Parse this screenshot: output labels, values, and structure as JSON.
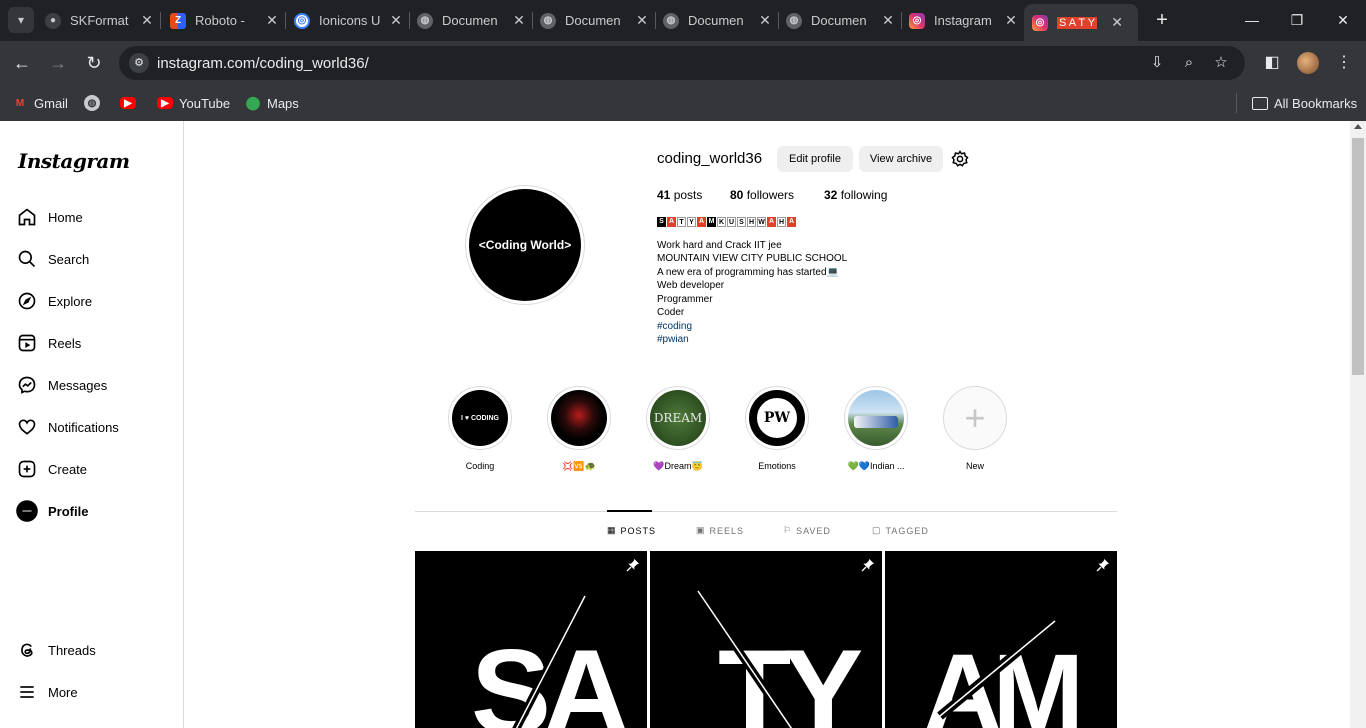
{
  "browser": {
    "tabs": [
      {
        "label": "SKFormat",
        "icon": "github-icon"
      },
      {
        "label": "Roboto -",
        "icon": "zb-icon"
      },
      {
        "label": "Ionicons U",
        "icon": "ionicons-icon"
      },
      {
        "label": "Documen",
        "icon": "globe-icon"
      },
      {
        "label": "Documen",
        "icon": "globe-icon"
      },
      {
        "label": "Documen",
        "icon": "globe-icon"
      },
      {
        "label": "Documen",
        "icon": "globe-icon"
      },
      {
        "label": "Instagram",
        "icon": "instagram-icon"
      },
      {
        "label": "S A T Y",
        "icon": "instagram-icon"
      }
    ],
    "url": "instagram.com/coding_world36/",
    "bookmarks": [
      {
        "label": "Gmail"
      },
      {
        "label": ""
      },
      {
        "label": ""
      },
      {
        "label": "YouTube"
      },
      {
        "label": "Maps"
      }
    ],
    "all_bookmarks": "All Bookmarks"
  },
  "sidebar": {
    "logo": "Instagram",
    "items": [
      {
        "label": "Home",
        "icon": "home-icon"
      },
      {
        "label": "Search",
        "icon": "search-icon"
      },
      {
        "label": "Explore",
        "icon": "compass-icon"
      },
      {
        "label": "Reels",
        "icon": "reels-icon"
      },
      {
        "label": "Messages",
        "icon": "messenger-icon"
      },
      {
        "label": "Notifications",
        "icon": "heart-icon"
      },
      {
        "label": "Create",
        "icon": "plus-square-icon"
      },
      {
        "label": "Profile",
        "icon": "profile-avatar-icon"
      }
    ],
    "threads": "Threads",
    "more": "More"
  },
  "profile": {
    "username": "coding_world36",
    "edit_profile": "Edit profile",
    "view_archive": "View archive",
    "posts_count": "41",
    "posts_label": "posts",
    "followers_count": "80",
    "followers_label": "followers",
    "following_count": "32",
    "following_label": "following",
    "full_name_letters": [
      "S",
      "A",
      "T",
      "Y",
      "A",
      "M",
      "K",
      "U",
      "S",
      "H",
      "W",
      "A",
      "H",
      "A"
    ],
    "avatar_text": "<Coding World>",
    "bio": [
      "Work hard and Crack IIT jee",
      "MOUNTAIN VIEW CITY PUBLIC SCHOOL",
      "A new era of programming has started💻",
      "Web developer",
      "Programmer",
      "Coder"
    ],
    "hashtags": [
      "#coding",
      "#pwian"
    ]
  },
  "highlights": [
    {
      "label": "Coding"
    },
    {
      "label": "💢🆚🐢"
    },
    {
      "label": "💜Dream😇"
    },
    {
      "label": "Emotions"
    },
    {
      "label": "💚💙Indian ..."
    },
    {
      "label": "New"
    }
  ],
  "highlight_texts": {
    "coding_img": "I ♥ CODING",
    "dream_img": "DREAM",
    "pw_img": "PW"
  },
  "profile_tabs": [
    {
      "label": "POSTS"
    },
    {
      "label": "REELS"
    },
    {
      "label": "SAVED"
    },
    {
      "label": "TAGGED"
    }
  ],
  "posts": [
    {
      "text": "SA",
      "pinned": true
    },
    {
      "text": "TY",
      "pinned": true
    },
    {
      "text": "AM",
      "pinned": true
    }
  ],
  "colors": {
    "accent_red": "#e0412b",
    "link": "#00376b",
    "chrome_dark": "#202124"
  }
}
